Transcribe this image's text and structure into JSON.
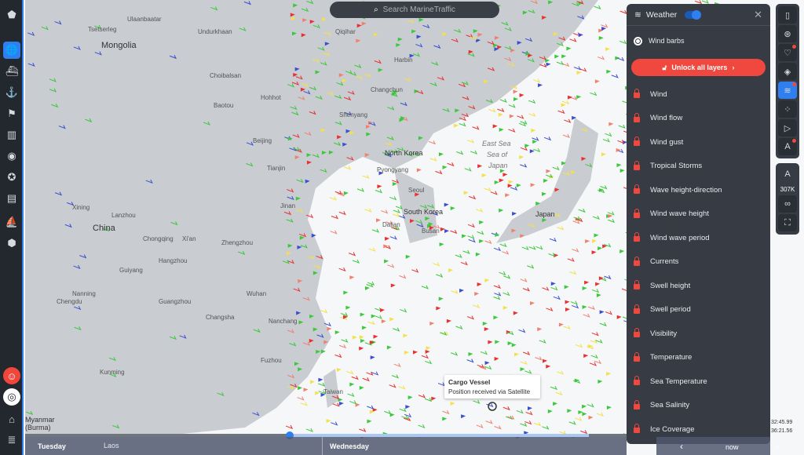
{
  "search": {
    "placeholder": "Search MarineTraffic",
    "icon": "search-icon"
  },
  "sidebar": {
    "items": [
      {
        "name": "logo",
        "glyph": "⬟"
      },
      {
        "name": "map",
        "glyph": "🌐"
      },
      {
        "name": "vessels",
        "glyph": "⛴"
      },
      {
        "name": "ports",
        "glyph": "⚓"
      },
      {
        "name": "lighthouse",
        "glyph": "⚑"
      },
      {
        "name": "buildings",
        "glyph": "▥"
      },
      {
        "name": "signal",
        "glyph": "◉"
      },
      {
        "name": "star",
        "glyph": "✪"
      },
      {
        "name": "dashboard",
        "glyph": "▤"
      },
      {
        "name": "fleet",
        "glyph": "⛵"
      },
      {
        "name": "box",
        "glyph": "⬢"
      }
    ],
    "bottom": [
      {
        "name": "user-alert",
        "glyph": "☺"
      },
      {
        "name": "account",
        "glyph": "◎"
      },
      {
        "name": "tag",
        "glyph": "⌂"
      },
      {
        "name": "database",
        "glyph": "≣"
      }
    ]
  },
  "weather_panel": {
    "title": "Weather",
    "toggle_on": true,
    "mode": "Wind barbs",
    "unlock_label": "Unlock all layers",
    "layers": [
      "Wind",
      "Wind flow",
      "Wind gust",
      "Tropical Storms",
      "Wave height-direction",
      "Wind wave height",
      "Wind wave period",
      "Currents",
      "Swell height",
      "Swell period",
      "Visibility",
      "Temperature",
      "Sea Temperature",
      "Sea Salinity",
      "Ice Coverage"
    ]
  },
  "toolbar": {
    "vessel_count": "307K",
    "items": [
      "map-layers",
      "filters",
      "favorites",
      "layers-stack",
      "weather",
      "density",
      "play",
      "measure"
    ]
  },
  "timeline": {
    "days": [
      "Tuesday",
      "Wednesday"
    ],
    "now_label": "now",
    "prev": "‹",
    "next": "›"
  },
  "tooltip": {
    "title": "Cargo Vessel",
    "subtitle": "Position received via Satellite"
  },
  "coords": [
    "32:45.99",
    "36:21.56"
  ],
  "map_labels": {
    "countries": [
      "Mongolia",
      "China",
      "North Korea",
      "South Korea",
      "Japan",
      "Myanmar (Burma)",
      "Laos"
    ],
    "seas": [
      "East Sea",
      "Sea of",
      "Japan"
    ],
    "cities": [
      "Ulaanbaatar",
      "Tsetserleg",
      "Undurkhaan",
      "Choibalsan",
      "Qiqihar",
      "Harbin",
      "Changchun",
      "Shenyang",
      "Dalian",
      "Tianjin",
      "Beijing",
      "Jinan",
      "Zhengzhou",
      "Xi'an",
      "Lanzhou",
      "Xining",
      "Wuhan",
      "Nanchang",
      "Changsha",
      "Guiyang",
      "Kunming",
      "Nanning",
      "Guangzhou",
      "Taiwan",
      "Seoul",
      "Pyongyang",
      "Busan",
      "Hohhot",
      "Baotou",
      "Chengdu",
      "Chongqing",
      "Hangzhou",
      "Fuzhou"
    ]
  },
  "colors": {
    "accent": "#2f7ff0",
    "danger": "#f0483e",
    "panel": "#363b44",
    "land": "#c9ccd1",
    "sea": "#f6f7f8"
  }
}
